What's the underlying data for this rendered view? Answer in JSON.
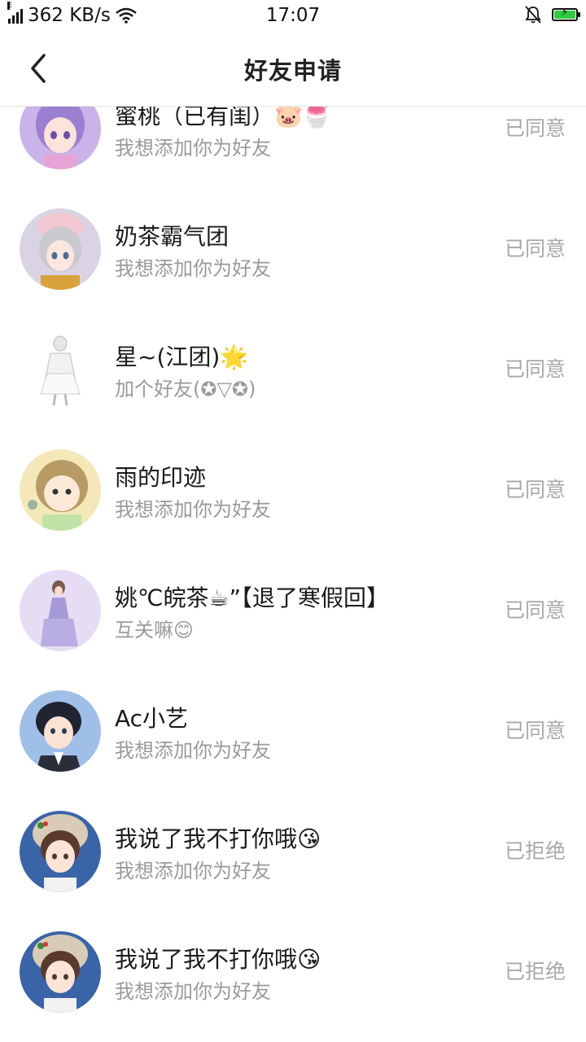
{
  "status_bar": {
    "speed": "362 KB/s",
    "time": "17:07",
    "signal_label": "E"
  },
  "header": {
    "title": "好友申请",
    "back_icon": "chevron-left-icon"
  },
  "requests": [
    {
      "name": "蜜桃（已有闺）🐷🍧",
      "message": "我想添加你为好友",
      "status": "已同意",
      "avatar_color": "#c9b3e8"
    },
    {
      "name": "奶茶霸气团",
      "message": "我想添加你为好友",
      "status": "已同意",
      "avatar_color": "#d9d3e3"
    },
    {
      "name": "星~(江团)🌟",
      "message": "加个好友(✪▽✪)",
      "status": "已同意",
      "avatar_color": "#ffffff"
    },
    {
      "name": "雨的印迹",
      "message": "我想添加你为好友",
      "status": "已同意",
      "avatar_color": "#f4e8b8"
    },
    {
      "name": "姚℃皖茶☕”【退了寒假回】",
      "message": "互关嘛😊",
      "status": "已同意",
      "avatar_color": "#e6ddf5"
    },
    {
      "name": "Ac小艺",
      "message": "我想添加你为好友",
      "status": "已同意",
      "avatar_color": "#9fbfe8"
    },
    {
      "name": "我说了我不打你哦😘",
      "message": "我想添加你为好友",
      "status": "已拒绝",
      "avatar_color": "#3a64a8"
    },
    {
      "name": "我说了我不打你哦😘",
      "message": "我想添加你为好友",
      "status": "已拒绝",
      "avatar_color": "#3a64a8"
    }
  ]
}
